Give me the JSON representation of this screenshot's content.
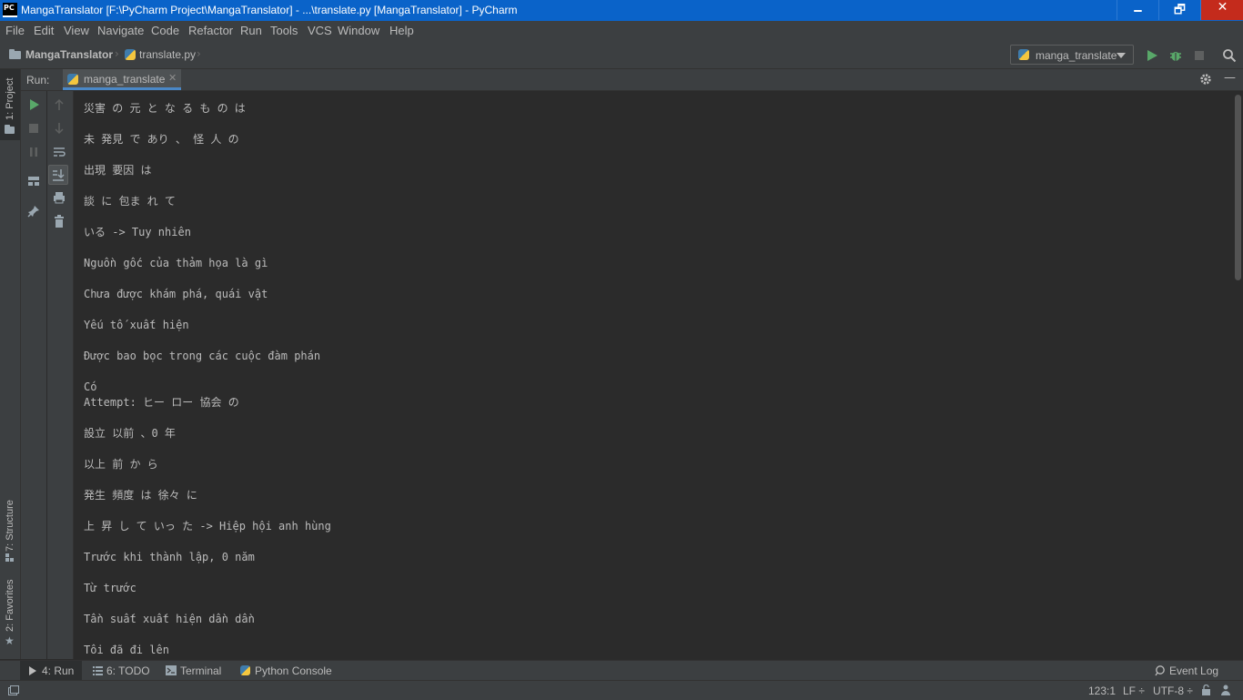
{
  "window": {
    "app_icon_text": "PC",
    "title": "MangaTranslator [F:\\PyCharm Project\\MangaTranslator] - ...\\translate.py [MangaTranslator] - PyCharm",
    "minimize": "🗕",
    "maximize": "🗗",
    "close": "✕"
  },
  "menu": {
    "file": "File",
    "edit": "Edit",
    "view": "View",
    "navigate": "Navigate",
    "code": "Code",
    "refactor": "Refactor",
    "run": "Run",
    "tools": "Tools",
    "vcs": "VCS",
    "window": "Window",
    "help": "Help"
  },
  "navbar": {
    "project": "MangaTranslator",
    "file": "translate.py",
    "run_config": "manga_translate"
  },
  "left_stripe": {
    "project_tab": "1: Project",
    "structure_tab": "7: Structure",
    "favorites_tab": "2: Favorites"
  },
  "run_panel": {
    "label": "Run:",
    "tab_name": "manga_translate",
    "tab_close": "✕",
    "hide": "—"
  },
  "console": {
    "lines": [
      "災害 の 元 と な る も の は",
      "",
      "未 発見 で あり 、 怪 人 の",
      "",
      "出現 要因 は",
      "",
      "談 に 包ま れ て",
      "",
      "いる -> Tuy nhiên",
      "",
      "Nguồn gốc của thảm họa là gì",
      "",
      "Chưa được khám phá, quái vật",
      "",
      "Yếu tố xuất hiện",
      "",
      "Được bao bọc trong các cuộc đàm phán",
      "",
      "Có",
      "Attempt: ヒー ロー 協会 の",
      "",
      "設立 以前 、0 年",
      "",
      "以上 前 か ら",
      "",
      "発生 頻度 は 徐々 に",
      "",
      "上 昇 し て いっ た -> Hiệp hội anh hùng",
      "",
      "Trước khi thành lập, 0 năm",
      "",
      "Từ trước",
      "",
      "Tần suất xuất hiện dần dần",
      "",
      "Tôi đã đi lên"
    ]
  },
  "bottom_tabs": {
    "run": "4: Run",
    "todo": "6: TODO",
    "terminal": "Terminal",
    "python_console": "Python Console",
    "event_log": "Event Log"
  },
  "status": {
    "position": "123:1",
    "line_sep": "LF ÷",
    "encoding": "UTF-8 ÷"
  },
  "colors": {
    "title_bar": "#0a63c9",
    "panel": "#3c3f41",
    "editor_bg": "#2b2b2b",
    "run_green": "#59a869",
    "accent_blue": "#4a88c7"
  }
}
